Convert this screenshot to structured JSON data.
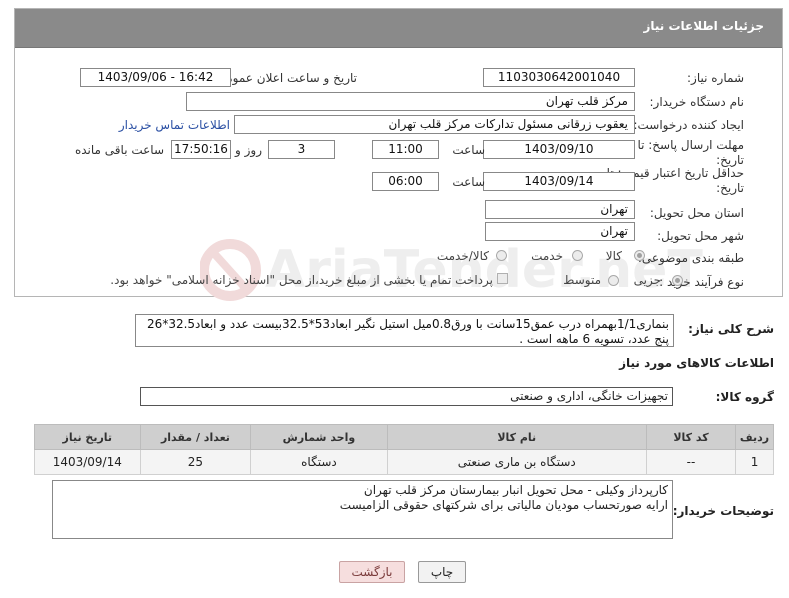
{
  "header": {
    "title": "جزئیات اطلاعات نیاز"
  },
  "need_number": {
    "label": "شماره نیاز:",
    "value": "1103030642001040"
  },
  "announce_date": {
    "label": "تاریخ و ساعت اعلان عمومی:",
    "value": "1403/09/06 - 16:42"
  },
  "buyer_org": {
    "label": "نام دستگاه خریدار:",
    "value": "مرکز قلب تهران"
  },
  "requester": {
    "label": "ایجاد کننده درخواست:",
    "value": "یعقوب زرقانی مسئول تدارکات مرکز قلب تهران",
    "contact_link": "اطلاعات تماس خریدار"
  },
  "deadline": {
    "label_line1": "مهلت ارسال پاسخ: تا",
    "label_line2": "تاریخ:",
    "date": "1403/09/10",
    "time_label": "ساعت",
    "time": "11:00",
    "days": "3",
    "days_label": "روز و",
    "remaining": "17:50:16",
    "remaining_label": "ساعت باقی مانده"
  },
  "price_validity": {
    "label_line1": "حداقل تاریخ اعتبار قیمت: تا",
    "label_line2": "تاریخ:",
    "date": "1403/09/14",
    "time_label": "ساعت",
    "time": "06:00"
  },
  "province": {
    "label": "استان محل تحویل:",
    "value": "تهران"
  },
  "city": {
    "label": "شهر محل تحویل:",
    "value": "تهران"
  },
  "category": {
    "label": "طبقه بندی موضوعی:",
    "options": [
      "کالا",
      "خدمت",
      "کالا/خدمت"
    ],
    "selected": "کالا"
  },
  "process": {
    "label": "نوع فرآیند خرید :",
    "options": [
      "جزیی",
      "متوسط"
    ],
    "selected": "جزیی",
    "payment_note": "پرداخت تمام یا بخشی از مبلغ خرید،از محل \"اسناد خزانه اسلامی\" خواهد بود."
  },
  "description": {
    "label": "شرح کلی نیاز:",
    "value": "بنماری1/1بهمراه درب عمق15سانت با ورق0.8میل استیل نگیر ابعاد53*32.5بیست عدد و ابعاد32.5*26 پنج عدد، تسویه 6 ماهه است ."
  },
  "goods_info": {
    "title": "اطلاعات کالاهای مورد نیاز"
  },
  "goods_group": {
    "label": "گروه کالا:",
    "value": "تجهیزات خانگی، اداری و صنعتی"
  },
  "table": {
    "headers": [
      "ردیف",
      "کد کالا",
      "نام کالا",
      "واحد شمارش",
      "تعداد / مقدار",
      "تاریخ نیاز"
    ],
    "rows": [
      [
        "1",
        "--",
        "دستگاه بن ماری صنعتی",
        "دستگاه",
        "25",
        "1403/09/14"
      ]
    ]
  },
  "buyer_notes": {
    "label": "توضیحات خریدار:",
    "line1": "کارپرداز وکیلی - محل تحویل انبار بیمارستان مرکز قلب تهران",
    "line2": "ارایه صورتحساب مودیان مالیاتی برای شرکتهای حقوقی الزامیست"
  },
  "buttons": {
    "print": "چاپ",
    "back": "بازگشت"
  },
  "watermark": {
    "text": "AriaTender.neT"
  },
  "colors": {
    "header_bg": "#8a8a8a",
    "link": "#2a4fa3",
    "back_button_bg": "#f6dede"
  }
}
